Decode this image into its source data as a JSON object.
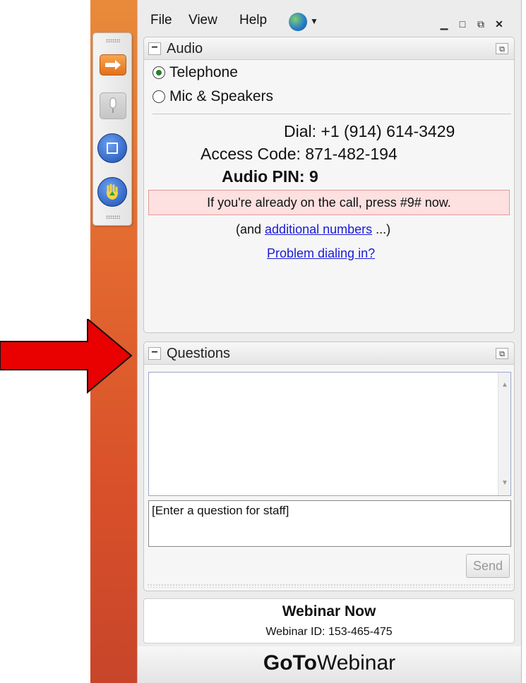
{
  "menu": {
    "file": "File",
    "view": "View",
    "help": "Help"
  },
  "audio": {
    "title": "Audio",
    "options": [
      {
        "label": "Telephone",
        "selected": true
      },
      {
        "label": "Mic & Speakers",
        "selected": false
      }
    ],
    "dial_label": "Dial:",
    "dial_value": "+1 (914) 614-3429",
    "access_label": "Access Code:",
    "access_value": "871-482-194",
    "pin_label": "Audio PIN:",
    "pin_value": "9",
    "alert": "If you're already on the call, press #9# now.",
    "more_prefix": "(and ",
    "more_link": "additional numbers",
    "more_suffix": " ...)",
    "problem_link": "Problem dialing in?"
  },
  "questions": {
    "title": "Questions",
    "input_placeholder": "[Enter a question for staff]",
    "send_label": "Send"
  },
  "webinar": {
    "title": "Webinar Now",
    "id_label": "Webinar ID: 153-465-475"
  },
  "brand": {
    "goto": "GoTo",
    "webinar": "Webinar"
  },
  "colors": {
    "arrow": "#e90000",
    "alert_bg": "#fde0e0",
    "link": "#1a1ad8",
    "accent_orange": "#e3701c"
  }
}
